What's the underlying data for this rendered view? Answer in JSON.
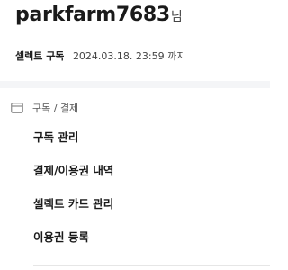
{
  "profile": {
    "username": "parkfarm7683",
    "honorific": "님"
  },
  "subscription": {
    "plan": "셀렉트 구독",
    "expiry": "2024.03.18. 23:59 까지"
  },
  "section": {
    "icon": "card-icon",
    "label": "구독 / 결제"
  },
  "menu": {
    "items": [
      {
        "label": "구독 관리"
      },
      {
        "label": "결제/이용권 내역"
      },
      {
        "label": "셀렉트 카드 관리"
      },
      {
        "label": "이용권 등록"
      }
    ]
  },
  "colors": {
    "text_primary": "#1a1a1a",
    "text_secondary": "#555555",
    "divider": "#f4f5f7"
  }
}
